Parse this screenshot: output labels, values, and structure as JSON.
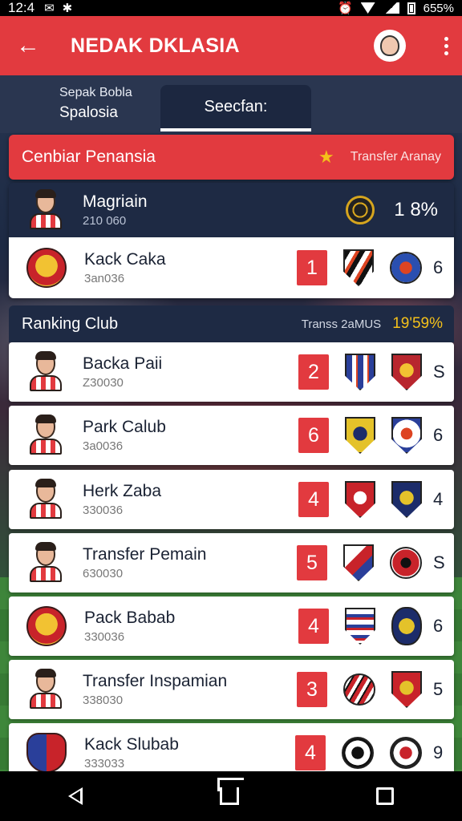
{
  "status_bar": {
    "time": "12:4",
    "battery": "655%"
  },
  "app_bar": {
    "title": "NEDAK DKLASIA"
  },
  "tabs": {
    "left_small": "Sepak Bobla",
    "left_big": "Spalosia",
    "active": "Seecfan:"
  },
  "banner": {
    "title": "Cenbiar Penansia",
    "right": "Transfer Aranay"
  },
  "featured": {
    "top": {
      "name": "Magriain",
      "sub": "210 060",
      "pct": "1 8%"
    },
    "bottom": {
      "name": "Kack Caka",
      "sub": "3an036",
      "rank": "1",
      "count": "6"
    }
  },
  "ranking": {
    "title": "Ranking Club",
    "mid": "Transs  2aMUS",
    "pct": "19'59%"
  },
  "rows": [
    {
      "name": "Backa Paii",
      "sub": "Z30030",
      "rank": "2",
      "count": "S",
      "avatar": "player"
    },
    {
      "name": "Park Calub",
      "sub": "3a0036",
      "rank": "6",
      "count": "6",
      "avatar": "player"
    },
    {
      "name": "Herk Zaba",
      "sub": "330036",
      "rank": "4",
      "count": "4",
      "avatar": "player"
    },
    {
      "name": "Transfer Pemain",
      "sub": "630030",
      "rank": "5",
      "count": "S",
      "avatar": "player"
    },
    {
      "name": "Pack Babab",
      "sub": "330036",
      "rank": "4",
      "count": "6",
      "avatar": "crest"
    },
    {
      "name": "Transfer Inspamian",
      "sub": "338030",
      "rank": "3",
      "count": "5",
      "avatar": "player"
    },
    {
      "name": "Kack Slubab",
      "sub": "333033",
      "rank": "4",
      "count": "9",
      "avatar": "crest"
    }
  ],
  "colors": {
    "accent_red": "#e23a3f",
    "navy": "#1e2a44",
    "gold": "#f4c01a"
  }
}
